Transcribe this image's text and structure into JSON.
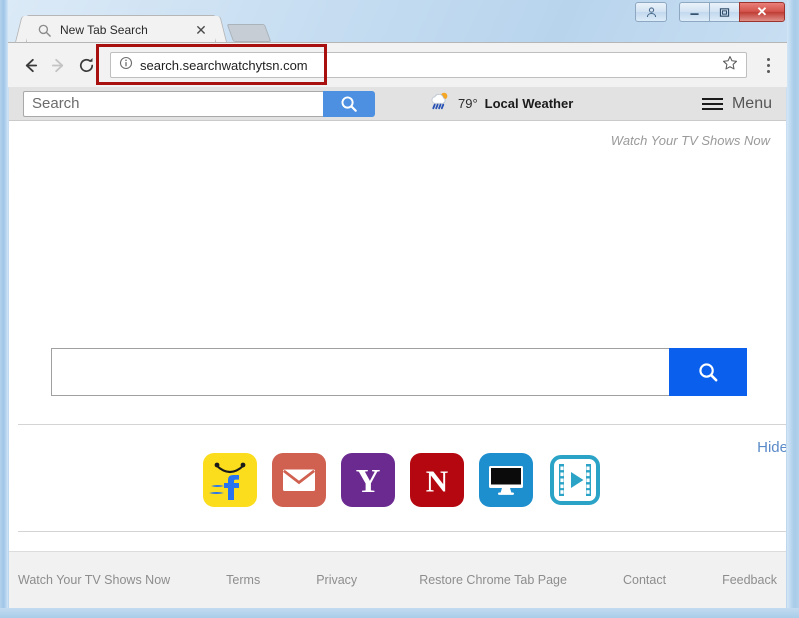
{
  "window": {
    "controls": {
      "user_icon": "user-account-icon",
      "minimize_label": "—",
      "maximize_label": "❐",
      "close_label": "✕"
    }
  },
  "browser": {
    "tab": {
      "favicon": "magnifier-icon",
      "title": "New Tab Search",
      "close_label": "✕"
    },
    "newtab_button": "new-tab-button",
    "nav": {
      "back": "back-arrow-icon",
      "forward": "forward-arrow-icon",
      "reload": "reload-icon"
    },
    "omnibox": {
      "info_icon": "page-info-icon",
      "url": "search.searchwatchytsn.com",
      "star_icon": "bookmark-star-icon"
    },
    "menu_icon": "three-dot-menu-icon"
  },
  "annotation": {
    "highlight_color": "#a81010",
    "target": "address-bar"
  },
  "sitebar": {
    "search_placeholder": "Search",
    "search_value": "",
    "search_button_icon": "search-icon",
    "weather": {
      "icon": "sun-rain-cloud-icon",
      "temperature": "79°",
      "label": "Local Weather"
    },
    "menu": {
      "icon": "hamburger-icon",
      "label": "Menu"
    }
  },
  "page": {
    "tagline": "Watch Your TV Shows Now",
    "main_search": {
      "value": "",
      "placeholder": "",
      "button_icon": "search-icon"
    },
    "tiles_panel": {
      "hide_label": "Hide",
      "tiles": [
        {
          "name": "flipkart",
          "icon": "flipkart-icon",
          "bg": "#fcdd1d"
        },
        {
          "name": "gmail",
          "icon": "gmail-envelope-icon",
          "bg": "#d0604f"
        },
        {
          "name": "yahoo",
          "icon": "yahoo-y-icon",
          "bg": "#6a2a8f"
        },
        {
          "name": "netflix",
          "icon": "netflix-n-icon",
          "bg": "#b5070f"
        },
        {
          "name": "tv",
          "icon": "monitor-icon",
          "bg": "#1e8fce"
        },
        {
          "name": "video",
          "icon": "film-play-icon",
          "bg": "#ffffff"
        }
      ]
    },
    "footer_links": [
      "Watch Your TV Shows Now",
      "Terms",
      "Privacy",
      "Restore Chrome Tab Page",
      "Contact",
      "Feedback"
    ]
  }
}
